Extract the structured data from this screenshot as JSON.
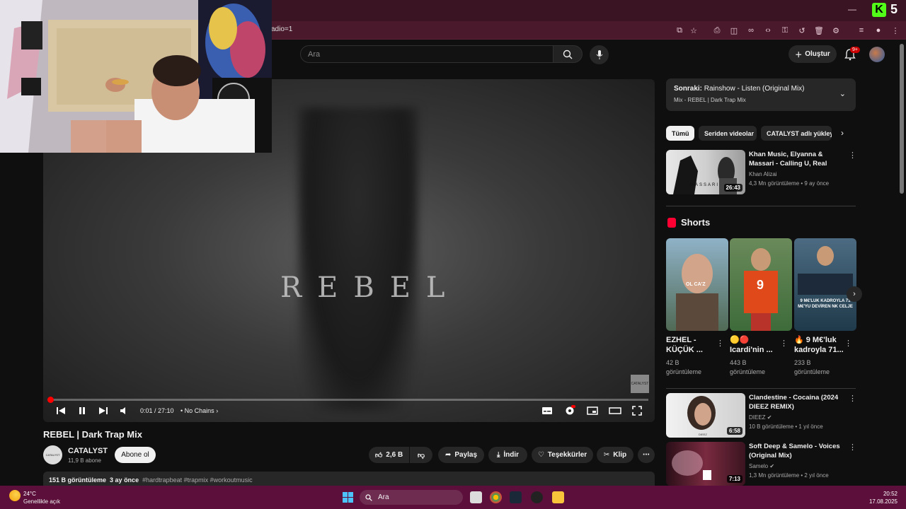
{
  "browser": {
    "url_fragment": "adio=1",
    "kick_count": "5"
  },
  "header": {
    "search_placeholder": "Ara",
    "create_label": "Oluştur",
    "notif_badge": "9+"
  },
  "player": {
    "overlay_text": "REBEL",
    "watermark": "CATALYST",
    "time": "0:01 / 27:10",
    "chapter": "No Chains",
    "progress_fraction": 0.001
  },
  "video": {
    "title": "REBEL | Dark Trap Mix",
    "channel": "CATALYST",
    "channel_avatar_text": "CATALYST",
    "subscribers": "11,9 B abone",
    "subscribe_label": "Abone ol",
    "likes": "2,6 B",
    "share_label": "Paylaş",
    "download_label": "İndir",
    "thanks_label": "Teşekkürler",
    "clip_label": "Klip",
    "views": "151 B görüntüleme",
    "age": "3 ay önce",
    "tags": "#hardtrapbeat #trapmix #workoutmusic"
  },
  "sidebar": {
    "up_next_prefix": "Sonraki:",
    "up_next_title": "Rainshow - Listen (Original Mix)",
    "up_next_sub": "Mix - REBEL | Dark Trap Mix",
    "chips": [
      "Tümü",
      "Seriden videolar",
      "CATALYST adlı yükleyi"
    ],
    "shorts_heading": "Shorts",
    "recommendations": [
      {
        "title": "Khan Music, Elyanna & Massari - Calling U, Real Love, BEBE, E ...",
        "channel": "Khan Alizai",
        "meta": "4,3 Mn görüntüleme • 9 ay önce",
        "duration": "26:43",
        "thumb_text": "MASSARI"
      },
      {
        "title": "Clandestine - Cocaina (2024 DIEEZ REMIX)",
        "channel": "DIEEZ",
        "meta": "10 B görüntüleme • 1 yıl önce",
        "duration": "6:58",
        "thumb_text": "DIEEZ"
      },
      {
        "title": "Soft Deep & Samelo - Voices (Original Mix)",
        "channel": "Samelo",
        "meta": "1,3 Mn görüntüleme • 2 yıl önce",
        "duration": "7:13"
      }
    ],
    "shorts": [
      {
        "title": "EZHEL - KÜÇÜK ...",
        "views": "42 B görüntüleme",
        "thumb_text": "OL CA'Z"
      },
      {
        "title": "🟡🔴 Icardi'nin ...",
        "views": "443 B görüntüleme",
        "thumb_text": "9"
      },
      {
        "title": "🔥 9 M€'luk kadroyla 71...",
        "views": "233 B görüntüleme",
        "thumb_text": "9 M€'LUK KADROYLA 71 M€'YU DEVİREN NK CELJE"
      }
    ]
  },
  "taskbar": {
    "temperature": "24°C",
    "condition": "Genellikle açık",
    "search_label": "Ara",
    "time": "20:52",
    "date": "17.08.2025"
  }
}
